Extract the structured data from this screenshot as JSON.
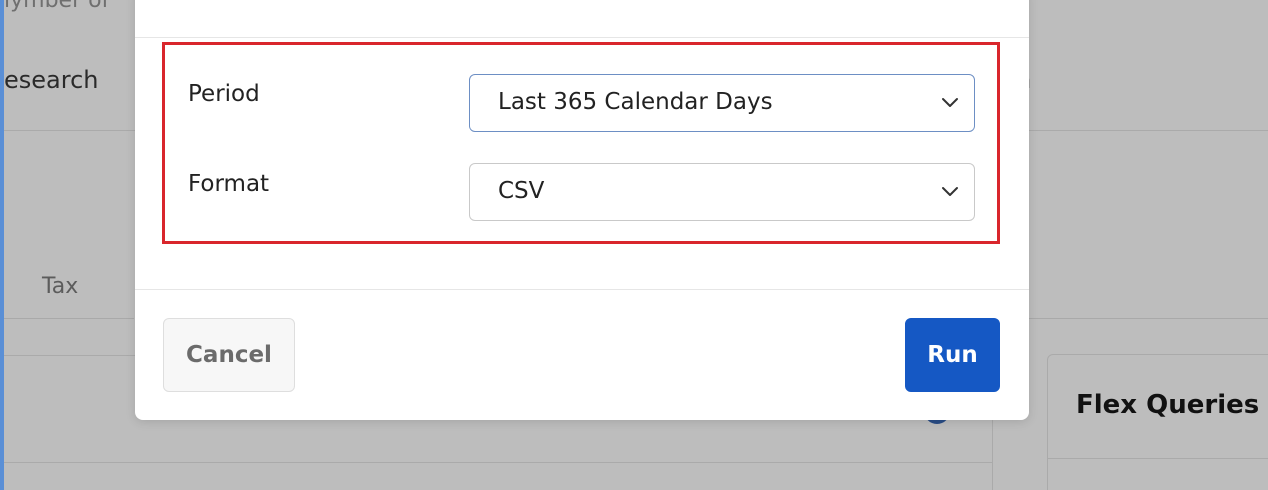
{
  "background": {
    "top_partial_text": "lymber of",
    "nav_left_partial": "esearch",
    "nav_right_partial": "n",
    "tab_tax": "Tax",
    "card_title": "Flex Queries"
  },
  "dialog": {
    "fields": [
      {
        "label": "Period",
        "value": "Last 365 Calendar Days"
      },
      {
        "label": "Format",
        "value": "CSV"
      }
    ],
    "cancel_label": "Cancel",
    "run_label": "Run",
    "highlight_color": "#d9262c",
    "primary_color": "#1558c4"
  }
}
